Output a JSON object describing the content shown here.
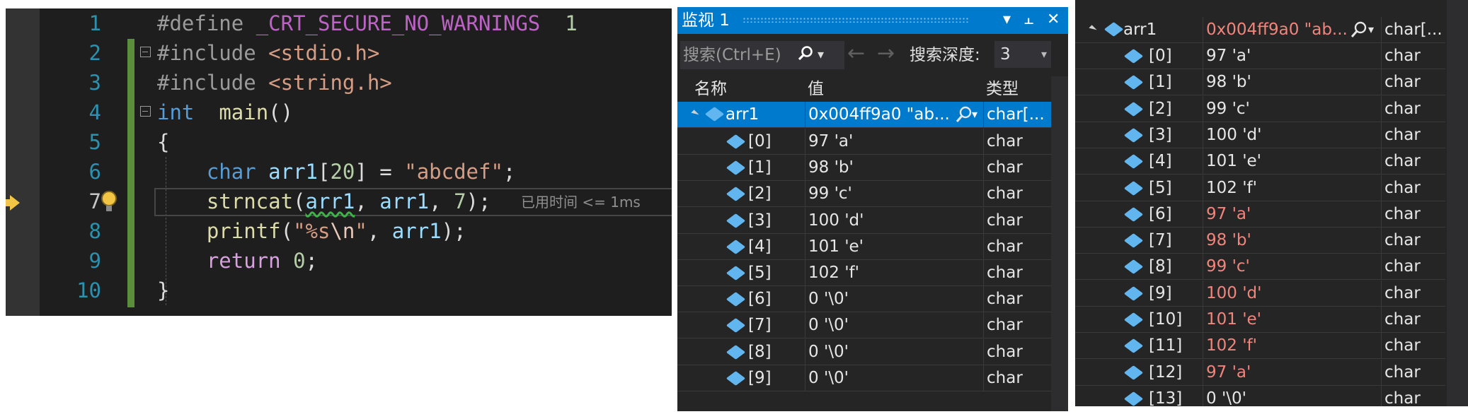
{
  "editor": {
    "lines": [
      {
        "num": "1",
        "tokens": [
          [
            "k-pre",
            "#define "
          ],
          [
            "k-macro",
            "_CRT_SECURE_NO_WARNINGS"
          ],
          [
            "",
            "  "
          ],
          [
            "k-num",
            "1"
          ]
        ]
      },
      {
        "num": "2",
        "tokens": [
          [
            "k-pre",
            "#include "
          ],
          [
            "k-str",
            "<stdio.h>"
          ]
        ]
      },
      {
        "num": "3",
        "tokens": [
          [
            "k-pre",
            "#include "
          ],
          [
            "k-str",
            "<string.h>"
          ]
        ]
      },
      {
        "num": "4",
        "tokens": [
          [
            "k-kw",
            "int"
          ],
          [
            "",
            "  "
          ],
          [
            "k-fn",
            "main"
          ],
          [
            "",
            "()"
          ]
        ]
      },
      {
        "num": "5",
        "tokens": [
          [
            "",
            "{"
          ]
        ]
      },
      {
        "num": "6",
        "tokens": [
          [
            "",
            "    "
          ],
          [
            "k-kw",
            "char"
          ],
          [
            "",
            " "
          ],
          [
            "k-var",
            "arr1"
          ],
          [
            "",
            "["
          ],
          [
            "k-num",
            "20"
          ],
          [
            "",
            "] = "
          ],
          [
            "k-str",
            "\"abcdef\""
          ],
          [
            "",
            ";"
          ]
        ]
      },
      {
        "num": "7",
        "tokens": [
          [
            "",
            "    "
          ],
          [
            "k-fn",
            "strncat"
          ],
          [
            "",
            "("
          ],
          [
            "k-var squiggle",
            "arr1"
          ],
          [
            "",
            ", "
          ],
          [
            "k-var",
            "arr1"
          ],
          [
            "",
            ", "
          ],
          [
            "k-num",
            "7"
          ],
          [
            "",
            ");"
          ]
        ]
      },
      {
        "num": "8",
        "tokens": [
          [
            "",
            "    "
          ],
          [
            "k-fn",
            "printf"
          ],
          [
            "",
            "("
          ],
          [
            "k-str",
            "\"%s"
          ],
          [
            "k-esc",
            "\\n"
          ],
          [
            "k-str",
            "\""
          ],
          [
            "",
            ", "
          ],
          [
            "k-var",
            "arr1"
          ],
          [
            "",
            ");"
          ]
        ]
      },
      {
        "num": "9",
        "tokens": [
          [
            "",
            "    "
          ],
          [
            "k-ctrl",
            "return"
          ],
          [
            "",
            " "
          ],
          [
            "k-num",
            "0"
          ],
          [
            "",
            ";"
          ]
        ]
      },
      {
        "num": "10",
        "tokens": [
          [
            "",
            "}"
          ]
        ]
      }
    ],
    "elapsed": "已用时间 <= 1ms"
  },
  "watch": {
    "title": "监视 1",
    "pin": "⫠",
    "close": "✕",
    "dropdown": "▾",
    "search_placeholder": "搜索(Ctrl+E)",
    "search_depth_label": "搜索深度:",
    "search_depth_value": "3",
    "nav_back": "←",
    "nav_forward": "→",
    "headers": {
      "name": "名称",
      "value": "值",
      "type": "类型"
    },
    "parent": {
      "name": "arr1",
      "value": "0x004ff9a0 \"ab...",
      "type": "char[..."
    },
    "items": [
      {
        "name": "[0]",
        "value": "97 'a'",
        "type": "char"
      },
      {
        "name": "[1]",
        "value": "98 'b'",
        "type": "char"
      },
      {
        "name": "[2]",
        "value": "99 'c'",
        "type": "char"
      },
      {
        "name": "[3]",
        "value": "100 'd'",
        "type": "char"
      },
      {
        "name": "[4]",
        "value": "101 'e'",
        "type": "char"
      },
      {
        "name": "[5]",
        "value": "102 'f'",
        "type": "char"
      },
      {
        "name": "[6]",
        "value": "0 '\\0'",
        "type": "char"
      },
      {
        "name": "[7]",
        "value": "0 '\\0'",
        "type": "char"
      },
      {
        "name": "[8]",
        "value": "0 '\\0'",
        "type": "char"
      },
      {
        "name": "[9]",
        "value": "0 '\\0'",
        "type": "char"
      }
    ]
  },
  "watch2": {
    "parent": {
      "name": "arr1",
      "value": "0x004ff9a0 \"ab...",
      "type": "char[..."
    },
    "items": [
      {
        "name": "[0]",
        "value": "97 'a'",
        "type": "char",
        "changed": false
      },
      {
        "name": "[1]",
        "value": "98 'b'",
        "type": "char",
        "changed": false
      },
      {
        "name": "[2]",
        "value": "99 'c'",
        "type": "char",
        "changed": false
      },
      {
        "name": "[3]",
        "value": "100 'd'",
        "type": "char",
        "changed": false
      },
      {
        "name": "[4]",
        "value": "101 'e'",
        "type": "char",
        "changed": false
      },
      {
        "name": "[5]",
        "value": "102 'f'",
        "type": "char",
        "changed": false
      },
      {
        "name": "[6]",
        "value": "97 'a'",
        "type": "char",
        "changed": true
      },
      {
        "name": "[7]",
        "value": "98 'b'",
        "type": "char",
        "changed": true
      },
      {
        "name": "[8]",
        "value": "99 'c'",
        "type": "char",
        "changed": true
      },
      {
        "name": "[9]",
        "value": "100 'd'",
        "type": "char",
        "changed": true
      },
      {
        "name": "[10]",
        "value": "101 'e'",
        "type": "char",
        "changed": true
      },
      {
        "name": "[11]",
        "value": "102 'f'",
        "type": "char",
        "changed": true
      },
      {
        "name": "[12]",
        "value": "97 'a'",
        "type": "char",
        "changed": true
      },
      {
        "name": "[13]",
        "value": "0 '\\0'",
        "type": "char",
        "changed": false
      }
    ]
  },
  "colors": {
    "accent": "#007acc",
    "changed_value": "#f0857c",
    "breakpoint_arrow": "#f3c544"
  }
}
